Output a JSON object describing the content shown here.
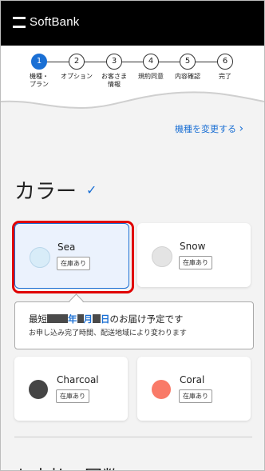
{
  "header": {
    "brand": "SoftBank"
  },
  "steps": [
    {
      "num": "1",
      "label": "機種・\nプラン",
      "active": true
    },
    {
      "num": "2",
      "label": "オプション",
      "active": false
    },
    {
      "num": "3",
      "label": "お客さま\n情報",
      "active": false
    },
    {
      "num": "4",
      "label": "規約同意",
      "active": false
    },
    {
      "num": "5",
      "label": "内容確認",
      "active": false
    },
    {
      "num": "6",
      "label": "完了",
      "active": false
    }
  ],
  "partial_link": {
    "text": "機種を変更する",
    "arrow": "›"
  },
  "color_section": {
    "title": "カラー",
    "check": "✓"
  },
  "colors": [
    {
      "name": "Sea",
      "stock": "在庫あり",
      "swatch": "#d8ecf8",
      "selected": true
    },
    {
      "name": "Snow",
      "stock": "在庫あり",
      "swatch": "#e4e4e4",
      "selected": false
    },
    {
      "name": "Charcoal",
      "stock": "在庫あり",
      "swatch": "#454545",
      "selected": false
    },
    {
      "name": "Coral",
      "stock": "在庫あり",
      "swatch": "#f97a68",
      "selected": false
    }
  ],
  "delivery": {
    "prefix": "最短",
    "year": "年",
    "month": "月",
    "day": "日",
    "suffix": "のお届け予定です",
    "note": "お申し込み完了時間、配送地域により変わります"
  },
  "bottom_partial": "お支払い回数"
}
